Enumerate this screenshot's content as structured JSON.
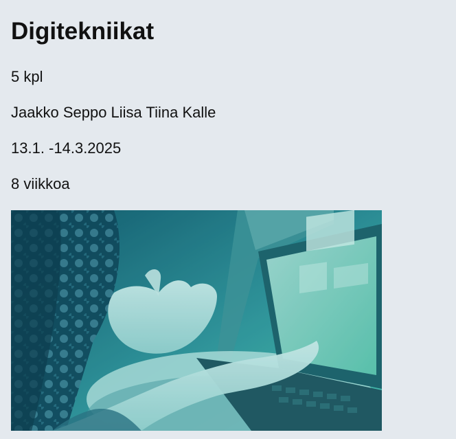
{
  "course": {
    "title": "Digitekniikat",
    "count": "5 kpl",
    "participants": "Jaakko Seppo Liisa Tiina Kalle",
    "dates": "13.1. -14.3.2025",
    "duration": "8 viikkoa"
  },
  "image": {
    "subject": "hands-gesturing-at-laptop-photo",
    "tint_start": "#0f4f66",
    "tint_end": "#4cc3b0"
  }
}
